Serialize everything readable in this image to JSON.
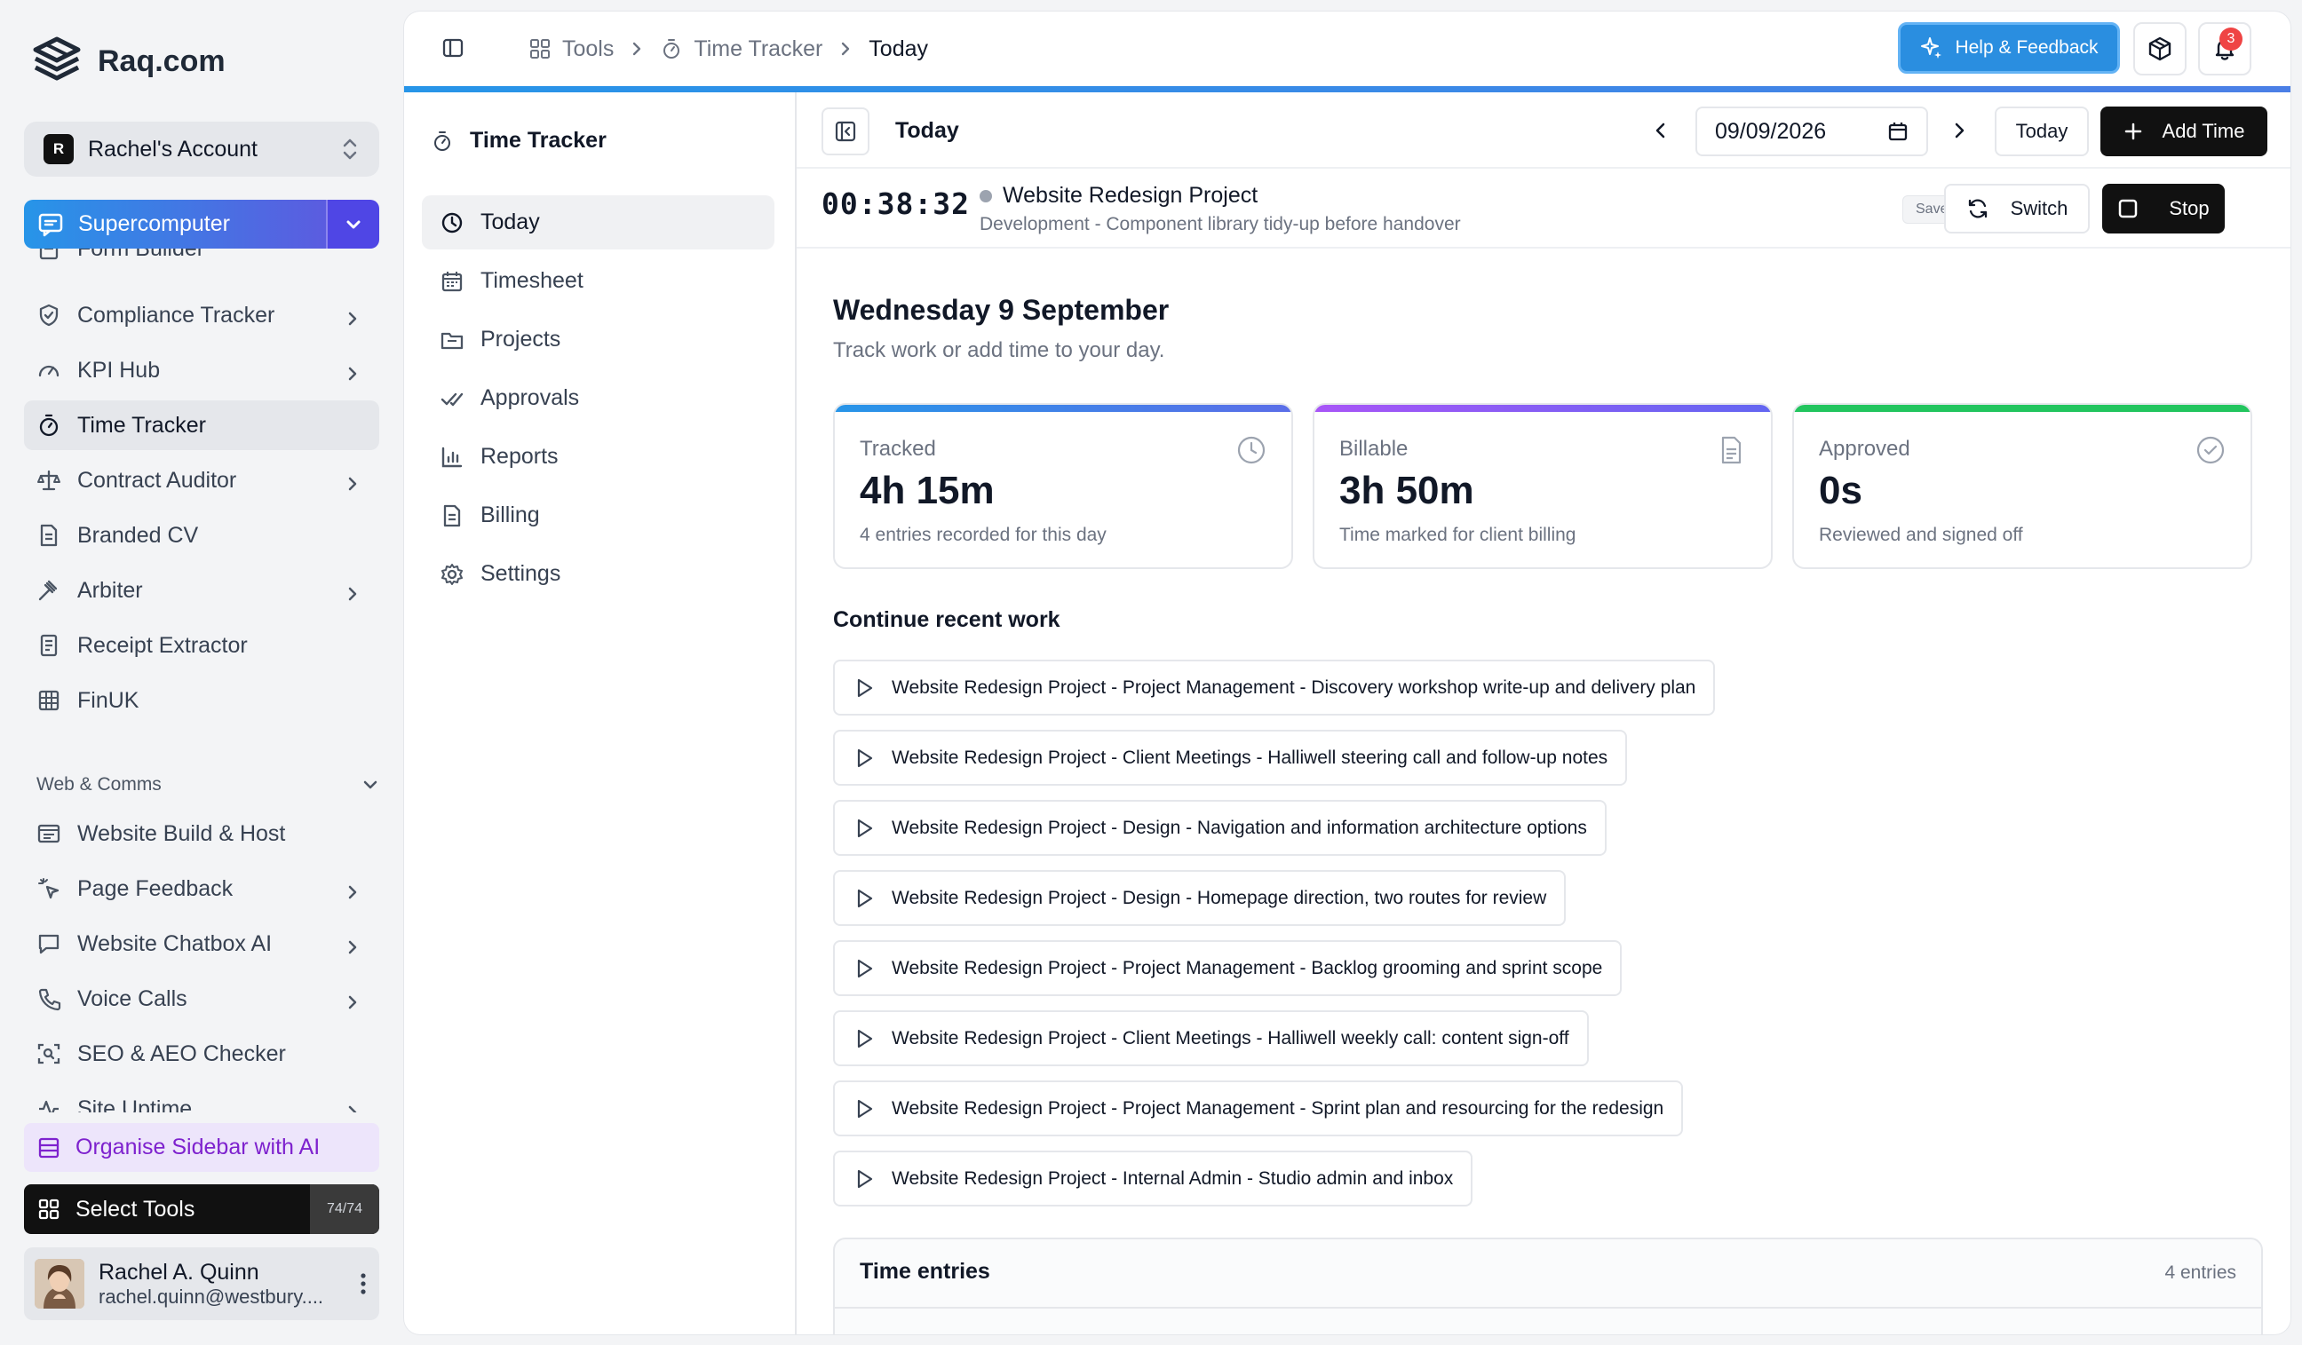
{
  "brand": {
    "name": "Raq.com"
  },
  "account": {
    "initial": "R",
    "name": "Rachel's Account"
  },
  "supercomputer": {
    "label": "Supercomputer"
  },
  "sidebar": {
    "items": [
      {
        "label": "Form Builder",
        "arrow": false
      },
      {
        "label": "Compliance Tracker",
        "arrow": true
      },
      {
        "label": "KPI Hub",
        "arrow": true
      },
      {
        "label": "Time Tracker",
        "arrow": false,
        "active": true
      },
      {
        "label": "Contract Auditor",
        "arrow": true
      },
      {
        "label": "Branded CV",
        "arrow": false
      },
      {
        "label": "Arbiter",
        "arrow": true
      },
      {
        "label": "Receipt Extractor",
        "arrow": false
      },
      {
        "label": "FinUK",
        "arrow": false
      }
    ],
    "section": "Web & Comms",
    "section_items": [
      {
        "label": "Website Build & Host",
        "arrow": false
      },
      {
        "label": "Page Feedback",
        "arrow": true
      },
      {
        "label": "Website Chatbox AI",
        "arrow": true
      },
      {
        "label": "Voice Calls",
        "arrow": true
      },
      {
        "label": "SEO & AEO Checker",
        "arrow": false
      },
      {
        "label": "Site Uptime",
        "arrow": true
      }
    ],
    "organise_label": "Organise Sidebar with AI",
    "select_tools_label": "Select Tools",
    "select_tools_count": "74/74"
  },
  "user": {
    "name": "Rachel A. Quinn",
    "email": "rachel.quinn@westbury...."
  },
  "breadcrumb": {
    "tools": "Tools",
    "tracker": "Time Tracker",
    "current": "Today"
  },
  "header": {
    "help_label": "Help & Feedback",
    "notification_count": "3"
  },
  "tracker_nav": {
    "title": "Time Tracker",
    "items": [
      {
        "label": "Today",
        "active": true
      },
      {
        "label": "Timesheet"
      },
      {
        "label": "Projects"
      },
      {
        "label": "Approvals"
      },
      {
        "label": "Reports"
      },
      {
        "label": "Billing"
      },
      {
        "label": "Settings"
      }
    ]
  },
  "content": {
    "title": "Today",
    "date_value": "09/09/2026",
    "today_button": "Today",
    "add_time_button": "Add Time",
    "timer": "00:38:32",
    "project": "Website Redesign Project",
    "project_detail": "Development - Component library tidy-up before handover",
    "saved_badge": "Saved",
    "switch_button": "Switch",
    "stop_button": "Stop",
    "day_heading": "Wednesday 9 September",
    "day_sub": "Track work or add time to your day."
  },
  "stats": [
    {
      "label": "Tracked",
      "value": "4h 15m",
      "sub": "4 entries recorded for this day",
      "color": "#4f8fe8",
      "icon": "clock-icon"
    },
    {
      "label": "Billable",
      "value": "3h 50m",
      "sub": "Time marked for client billing",
      "color": "#8b5cf6",
      "icon": "document-icon"
    },
    {
      "label": "Approved",
      "value": "0s",
      "sub": "Reviewed and signed off",
      "color": "#22c55e",
      "icon": "check-circle-icon"
    }
  ],
  "recent": {
    "heading": "Continue recent work",
    "items": [
      "Website Redesign Project - Project Management - Discovery workshop write-up and delivery plan",
      "Website Redesign Project - Client Meetings - Halliwell steering call and follow-up notes",
      "Website Redesign Project - Design - Navigation and information architecture options",
      "Website Redesign Project - Design - Homepage direction, two routes for review",
      "Website Redesign Project - Project Management - Backlog grooming and sprint scope",
      "Website Redesign Project - Client Meetings - Halliwell weekly call: content sign-off",
      "Website Redesign Project - Project Management - Sprint plan and resourcing for the redesign",
      "Website Redesign Project - Internal Admin - Studio admin and inbox"
    ]
  },
  "entries": {
    "heading": "Time entries",
    "count": "4 entries"
  }
}
